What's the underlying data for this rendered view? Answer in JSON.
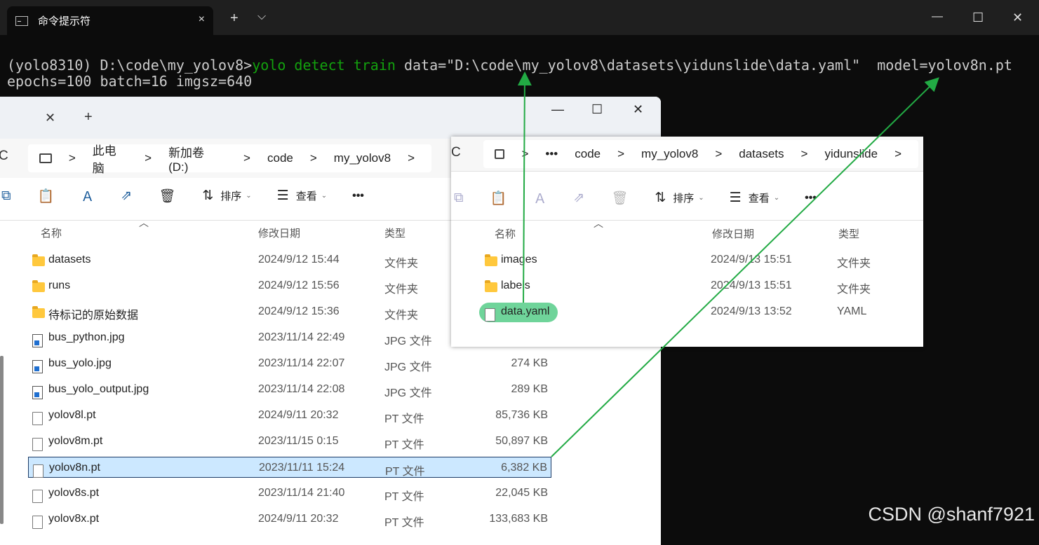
{
  "terminal": {
    "tab_title": "命令提示符",
    "tab_close": "×",
    "new_tab": "+",
    "dropdown": "⌵",
    "minimize": "—",
    "maximize": "☐",
    "close": "✕",
    "prompt": "(yolo8310) D:\\code\\my_yolov8>",
    "command": "yolo detect train",
    "args_line1": " data=\"D:\\code\\my_yolov8\\datasets\\yidunslide\\data.yaml\"  model=yolov8n.pt",
    "args_line2": "epochs=100 batch=16 imgsz=640",
    "colors": {
      "bg": "#0c0c0c",
      "text": "#cccccc",
      "command": "#13a10e"
    }
  },
  "explorer_main": {
    "tab_close": "✕",
    "tab_add": "+",
    "minimize": "—",
    "maximize": "☐",
    "close": "✕",
    "refresh_icon": "C",
    "breadcrumb": [
      "此电脑",
      "新加卷 (D:)",
      "code",
      "my_yolov8"
    ],
    "sep": ">",
    "toolbar": {
      "sort": "排序",
      "view": "查看",
      "more": "•••"
    },
    "columns": {
      "name": "名称",
      "date": "修改日期",
      "type": "类型"
    },
    "rows": [
      {
        "icon": "folder-icon",
        "name": "datasets",
        "date": "2024/9/12 15:44",
        "type": "文件夹",
        "size": ""
      },
      {
        "icon": "folder-icon",
        "name": "runs",
        "date": "2024/9/12 15:56",
        "type": "文件夹",
        "size": ""
      },
      {
        "icon": "folder-icon",
        "name": "待标记的原始数据",
        "date": "2024/9/12 15:36",
        "type": "文件夹",
        "size": ""
      },
      {
        "icon": "jpg-file-icon",
        "name": "bus_python.jpg",
        "date": "2023/11/14 22:49",
        "type": "JPG 文件",
        "size": ""
      },
      {
        "icon": "jpg-file-icon",
        "name": "bus_yolo.jpg",
        "date": "2023/11/14 22:07",
        "type": "JPG 文件",
        "size": "274 KB"
      },
      {
        "icon": "jpg-file-icon",
        "name": "bus_yolo_output.jpg",
        "date": "2023/11/14 22:08",
        "type": "JPG 文件",
        "size": "289 KB"
      },
      {
        "icon": "file-icon",
        "name": "yolov8l.pt",
        "date": "2024/9/11 20:32",
        "type": "PT 文件",
        "size": "85,736 KB"
      },
      {
        "icon": "file-icon",
        "name": "yolov8m.pt",
        "date": "2023/11/15 0:15",
        "type": "PT 文件",
        "size": "50,897 KB"
      },
      {
        "icon": "file-icon",
        "name": "yolov8n.pt",
        "date": "2023/11/11 15:24",
        "type": "PT 文件",
        "size": "6,382 KB",
        "selected": true
      },
      {
        "icon": "file-icon",
        "name": "yolov8s.pt",
        "date": "2023/11/14 21:40",
        "type": "PT 文件",
        "size": "22,045 KB"
      },
      {
        "icon": "file-icon",
        "name": "yolov8x.pt",
        "date": "2024/9/11 20:32",
        "type": "PT 文件",
        "size": "133,683 KB"
      }
    ]
  },
  "explorer_overlay": {
    "refresh_icon": "C",
    "breadcrumb": [
      "•••",
      "code",
      "my_yolov8",
      "datasets",
      "yidunslide"
    ],
    "sep": ">",
    "toolbar": {
      "sort": "排序",
      "view": "查看",
      "more": "•••"
    },
    "columns": {
      "name": "名称",
      "date": "修改日期",
      "type": "类型"
    },
    "rows": [
      {
        "icon": "folder-icon",
        "name": "images",
        "date": "2024/9/13 15:51",
        "type": "文件夹"
      },
      {
        "icon": "folder-icon",
        "name": "labels",
        "date": "2024/9/13 15:51",
        "type": "文件夹"
      },
      {
        "icon": "file-icon",
        "name": "data.yaml",
        "date": "2024/9/13 13:52",
        "type": "YAML",
        "highlighted": true
      }
    ],
    "highlight_color": "#6fd49a"
  },
  "watermark": "CSDN @shanf7921",
  "annotation_color": "#22aa44"
}
